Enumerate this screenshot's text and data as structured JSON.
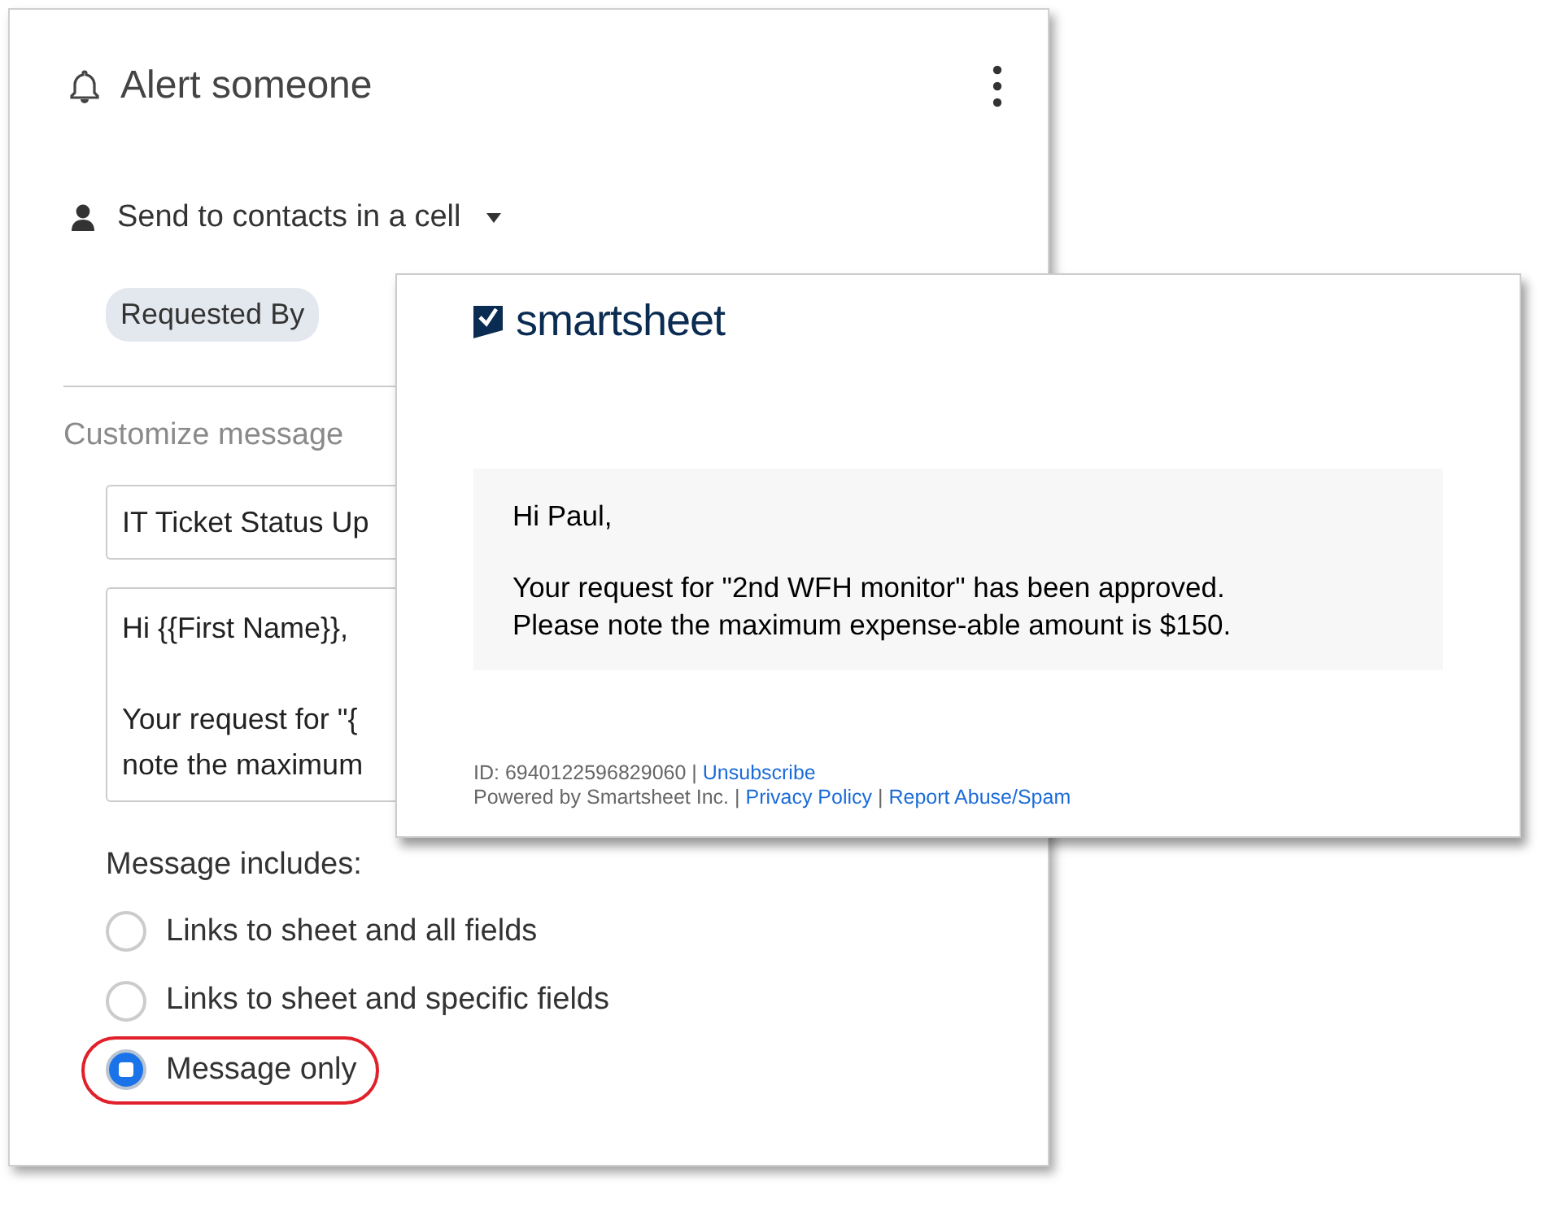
{
  "panel": {
    "title": "Alert someone",
    "recipient": {
      "label": "Send to contacts in a cell"
    },
    "chips": [
      "Requested By"
    ],
    "section_title": "Customize message",
    "subject": {
      "value": "IT Ticket Status Up"
    },
    "body": {
      "paragraphs": [
        [
          "Hi {{First Name}},"
        ],
        [
          "Your request for \"{",
          "note the maximum"
        ]
      ]
    },
    "includes_label": "Message includes:",
    "options": [
      {
        "label": "Links to sheet and all fields",
        "selected": false,
        "highlighted": false
      },
      {
        "label": "Links to sheet and specific fields",
        "selected": false,
        "highlighted": false
      },
      {
        "label": "Message only",
        "selected": true,
        "highlighted": true
      }
    ]
  },
  "email": {
    "brand": "smartsheet",
    "greeting": "Hi Paul,",
    "message": "Your request for \"2nd WFH monitor\" has been approved.\nPlease note the maximum expense-able amount is $150.",
    "footer": [
      [
        {
          "kind": "text",
          "text": "ID: 6940122596829060 |"
        },
        {
          "kind": "link",
          "text": "Unsubscribe"
        }
      ],
      [
        {
          "kind": "text",
          "text": "Powered by Smartsheet Inc. |"
        },
        {
          "kind": "link",
          "text": "Privacy Policy"
        },
        {
          "kind": "text",
          "text": "|"
        },
        {
          "kind": "link",
          "text": "Report Abuse/Spam"
        }
      ]
    ]
  }
}
